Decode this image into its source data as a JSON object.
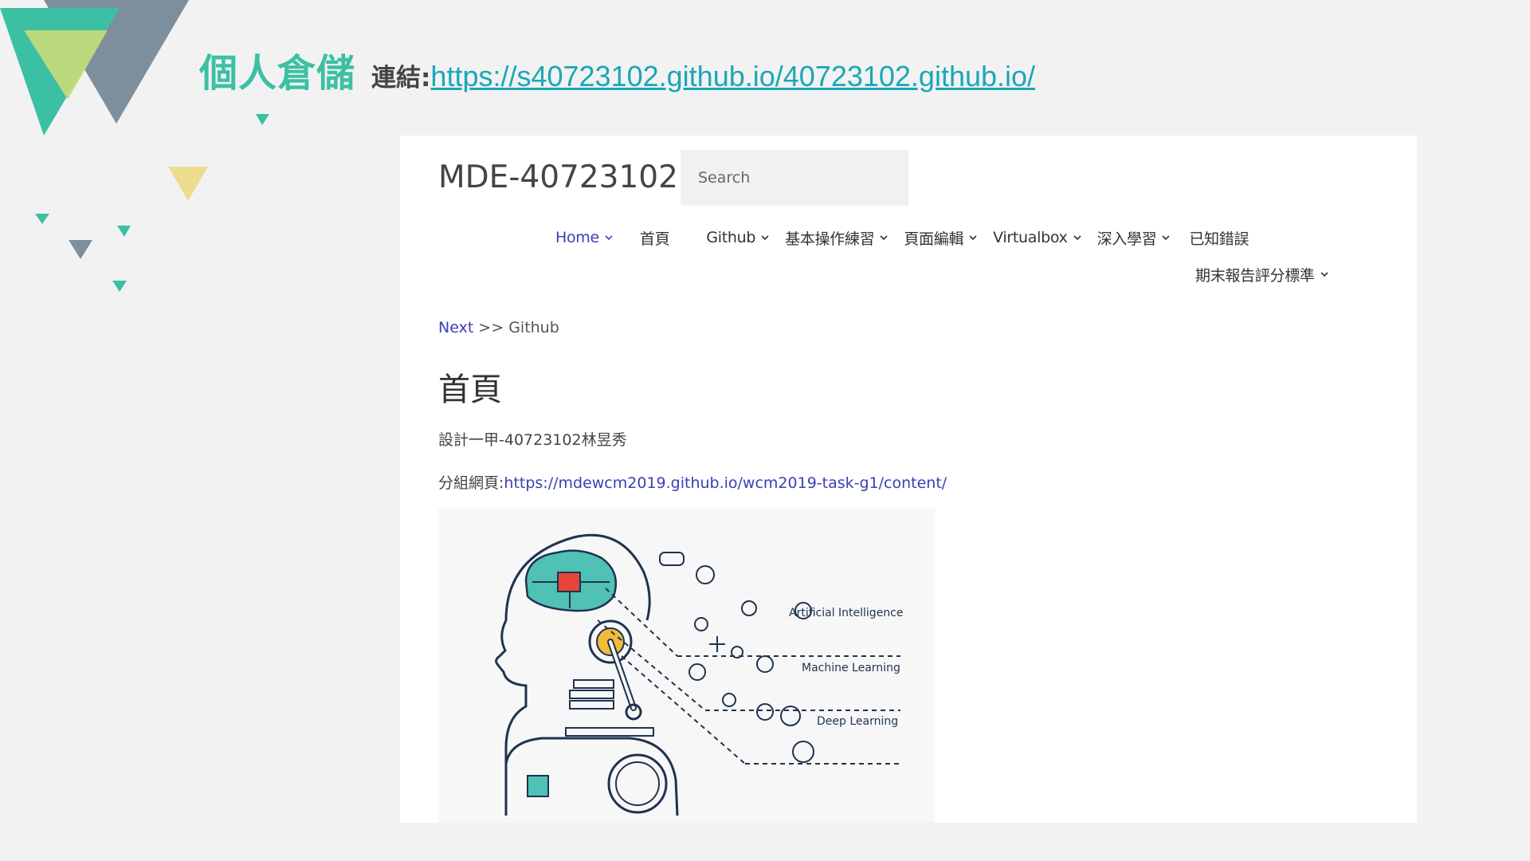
{
  "slide": {
    "heading": "個人倉儲",
    "link_label": "連結:",
    "link_url": "https://s40723102.github.io/40723102.github.io/"
  },
  "site": {
    "title": "MDE-40723102",
    "search_placeholder": "Search",
    "nav": {
      "home": "Home",
      "shouye": "首頁",
      "github": "Github",
      "basic": "基本操作練習",
      "page_edit": "頁面編輯",
      "virtualbox": "Virtualbox",
      "deep": "深入學習",
      "known_errors": "已知錯誤",
      "final": "期末報告評分標準"
    },
    "breadcrumb": {
      "next": "Next",
      "sep": " >> ",
      "current": "Github"
    },
    "page_heading": "首頁",
    "line1": "設計一甲-40723102林昱秀",
    "line2_label": "分組網頁:",
    "line2_link": "https://mdewcm2019.github.io/wcm2019-task-g1/content/",
    "image_labels": {
      "ai": "Artificial Intelligence",
      "ml": "Machine Learning",
      "dl": "Deep Learning"
    }
  },
  "colors": {
    "teal": "#3cc0a3",
    "slate": "#7d8e9c",
    "lime": "#c8dc78",
    "yellow": "#ecdc8e",
    "link_blue": "#3d3db8",
    "slide_link": "#1ba7b5"
  }
}
